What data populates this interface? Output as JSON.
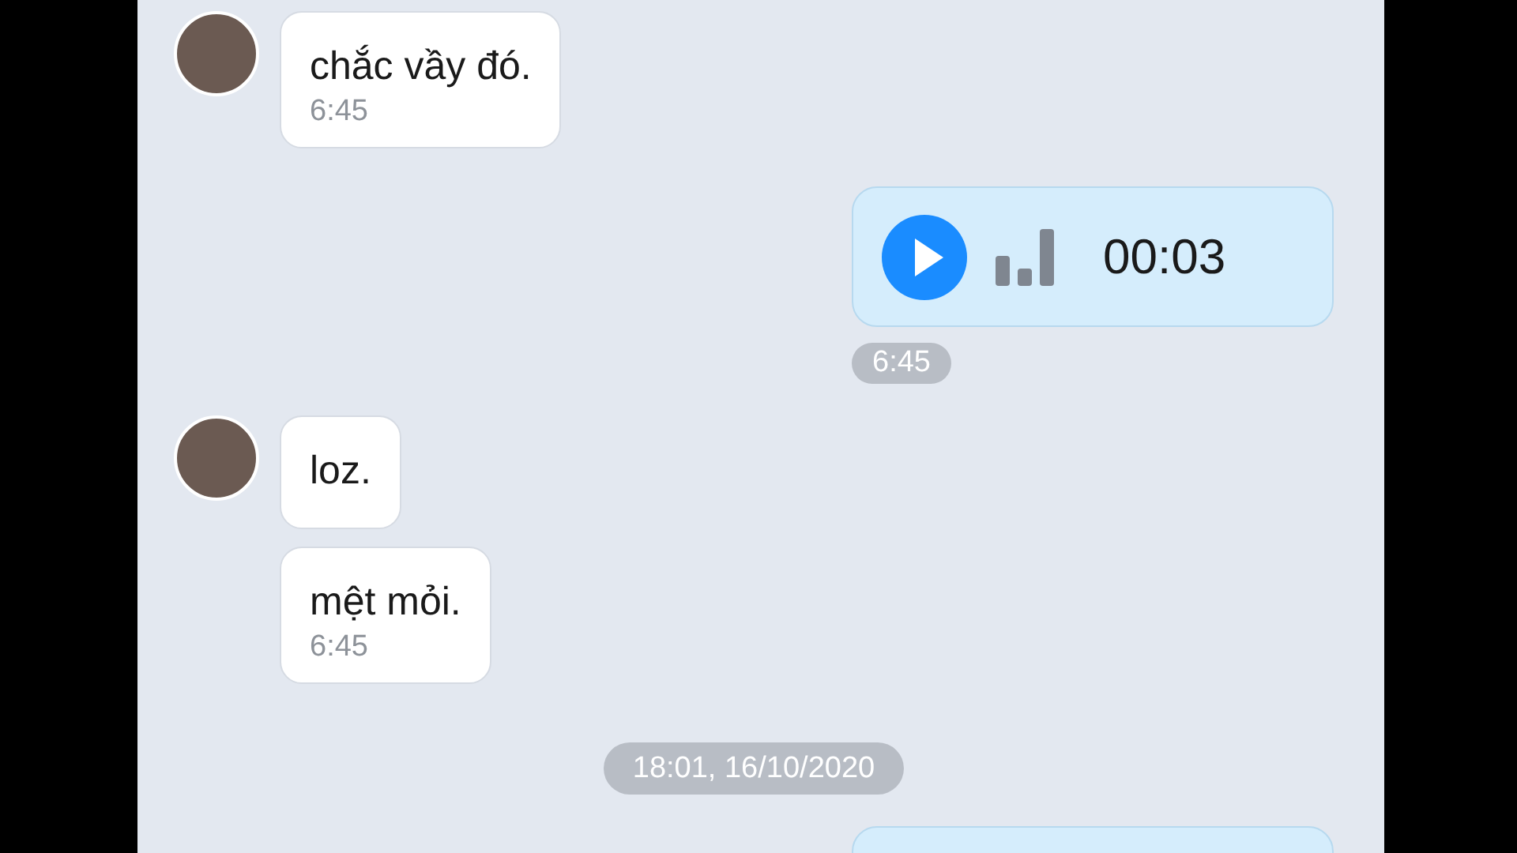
{
  "messages": [
    {
      "kind": "incoming",
      "avatar": true,
      "text": "chắc vầy đó.",
      "time": "6:45"
    },
    {
      "kind": "voice",
      "duration": "00:03",
      "time": "6:45"
    },
    {
      "kind": "incoming",
      "avatar": true,
      "text": "loz."
    },
    {
      "kind": "incoming",
      "avatar": false,
      "text": "mệt mỏi.",
      "time": "6:45"
    },
    {
      "kind": "date",
      "text": "18:01, 16/10/2020"
    },
    {
      "kind": "outgoing_cut"
    }
  ]
}
